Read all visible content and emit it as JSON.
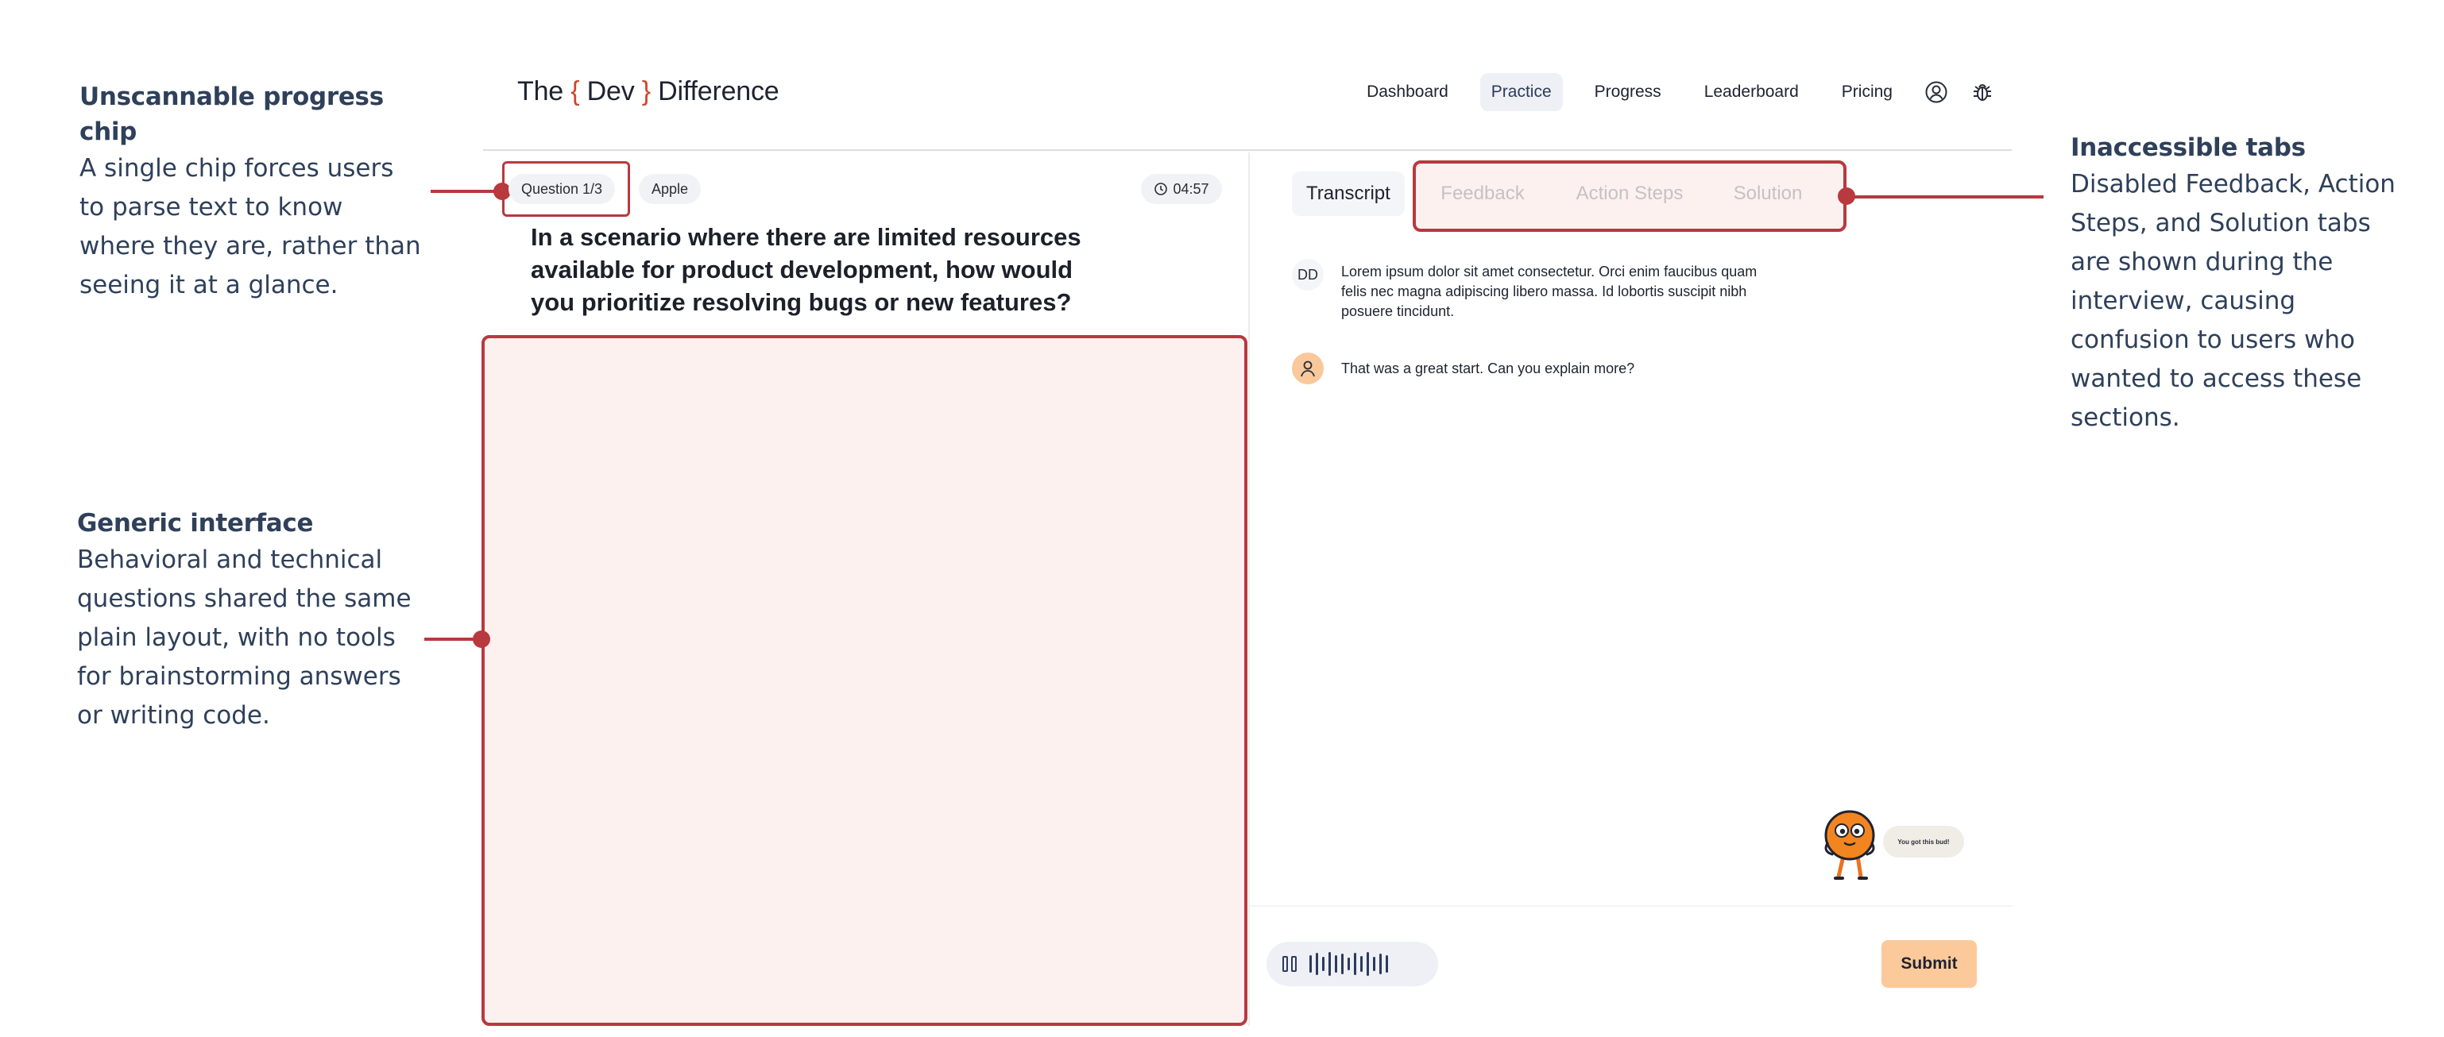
{
  "annotations": {
    "chip": {
      "title": "Unscannable progress chip",
      "body": "A single chip forces users to parse text to know where they are, rather than seeing it at a glance."
    },
    "generic": {
      "title": "Generic interface",
      "body": "Behavioral and technical questions shared the same plain layout, with no tools for brainstorming answers or writing code."
    },
    "tabs": {
      "title": "Inaccessible tabs",
      "body": "Disabled Feedback, Action Steps, and Solution tabs are shown during the interview, causing confusion to users who wanted to access these sections."
    }
  },
  "header": {
    "logo": {
      "part1": "The ",
      "brace_open": "{",
      "part2": " Dev ",
      "brace_close": "}",
      "part3": " Difference"
    },
    "nav": [
      {
        "label": "Dashboard",
        "active": false
      },
      {
        "label": "Practice",
        "active": true
      },
      {
        "label": "Progress",
        "active": false
      },
      {
        "label": "Leaderboard",
        "active": false
      },
      {
        "label": "Pricing",
        "active": false
      }
    ],
    "icons": [
      "user-circle-icon",
      "bug-icon"
    ]
  },
  "question_panel": {
    "progress_chip": "Question 1/3",
    "company_chip": "Apple",
    "timer": "04:57",
    "question": "In a scenario where there are limited resources available for product development, how would you prioritize resolving bugs or new features?"
  },
  "tabs": {
    "transcript": "Transcript",
    "feedback": "Feedback",
    "action_steps": "Action Steps",
    "solution": "Solution"
  },
  "transcript": [
    {
      "avatar": "DD",
      "text": "Lorem ipsum dolor sit amet consectetur. Orci enim faucibus quam felis nec magna adipiscing libero massa. Id lobortis suscipit nibh posuere tincidunt."
    },
    {
      "avatar": "user-icon",
      "text": "That was a great start. Can you explain more?"
    }
  ],
  "mascot": {
    "bubble": "You got this bud!"
  },
  "controls": {
    "submit_label": "Submit"
  },
  "colors": {
    "accent": "#b8393e",
    "highlight_fill": "#fdf1f0",
    "submit": "#fbc99a",
    "brace": "#d2452f",
    "annotation_text": "#2f405a"
  }
}
